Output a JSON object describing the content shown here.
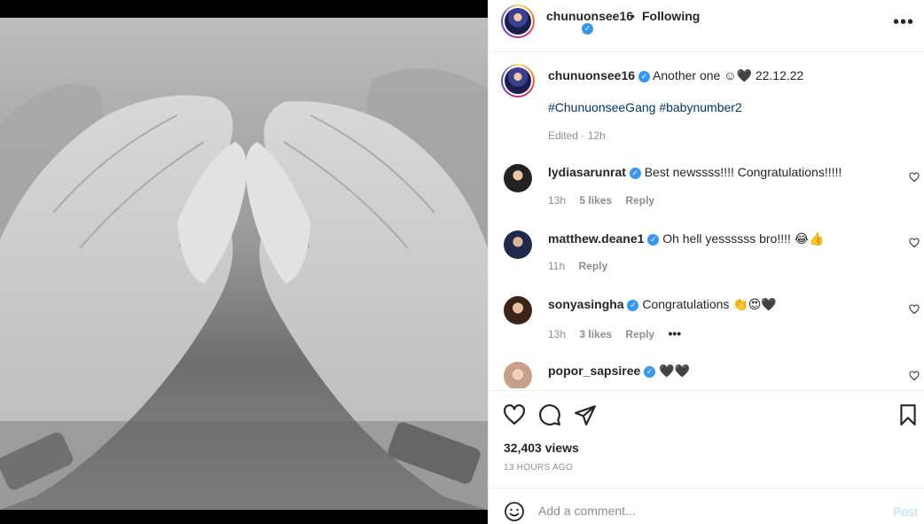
{
  "post": {
    "username": "chunuonsee16",
    "separator": "•",
    "follow_status": "Following",
    "verified_icon": "verified-badge-icon",
    "more_label": "•••"
  },
  "caption": {
    "username": "chunuonsee16",
    "text": "Another one ☺🖤 22.12.22",
    "hashtags": "#ChunuonseeGang #babynumber2",
    "edited": "Edited · 12h"
  },
  "comments": [
    {
      "username": "lydiasarunrat",
      "text": "Best newssss!!!! Congratulations!!!!!",
      "time": "13h",
      "likes": "5 likes",
      "reply": "Reply"
    },
    {
      "username": "matthew.deane1",
      "text": "Oh hell yessssss bro!!!! 😂👍",
      "time": "11h",
      "likes": "",
      "reply": "Reply"
    },
    {
      "username": "sonyasingha",
      "text": "Congratulations 👏😍🖤",
      "time": "13h",
      "likes": "3 likes",
      "reply": "Reply",
      "more": "•••"
    },
    {
      "username": "popor_sapsiree",
      "text": "🖤🖤",
      "time": "",
      "likes": "",
      "reply": ""
    }
  ],
  "actions": {
    "icons": [
      "heart-icon",
      "comment-icon",
      "share-icon",
      "bookmark-icon"
    ],
    "views": "32,403 views",
    "time_ago": "13 HOURS AGO"
  },
  "add_comment": {
    "placeholder": "Add a comment...",
    "post_label": "Post"
  },
  "colors": {
    "link": "#00376b",
    "verified": "#3897f0",
    "muted": "#8e8e8e",
    "post_disabled": "#b2dffc"
  }
}
